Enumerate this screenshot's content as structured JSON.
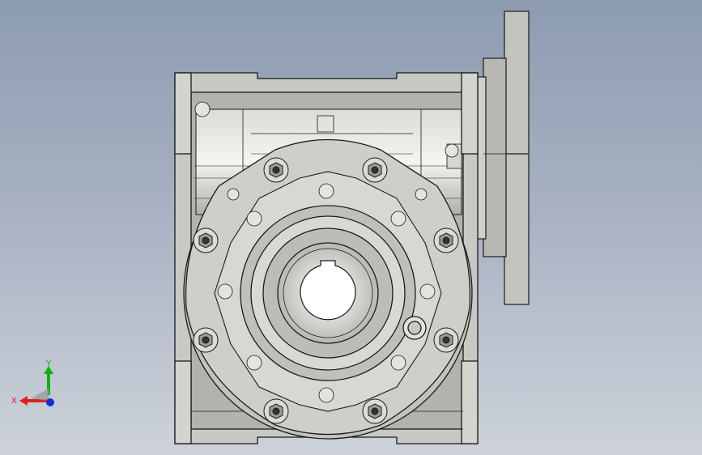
{
  "viewport": {
    "background_top": "#8d9bb1",
    "background_bottom": "#cdd2da"
  },
  "model": {
    "body_color": "#c9c9c3",
    "edge_color": "#1a1a1a",
    "shadow_color": "#8f8f89"
  },
  "triad": {
    "x_label": "X",
    "y_label": "Y",
    "x_color": "#e02020",
    "y_color": "#10b010",
    "z_color": "#1030d0"
  }
}
